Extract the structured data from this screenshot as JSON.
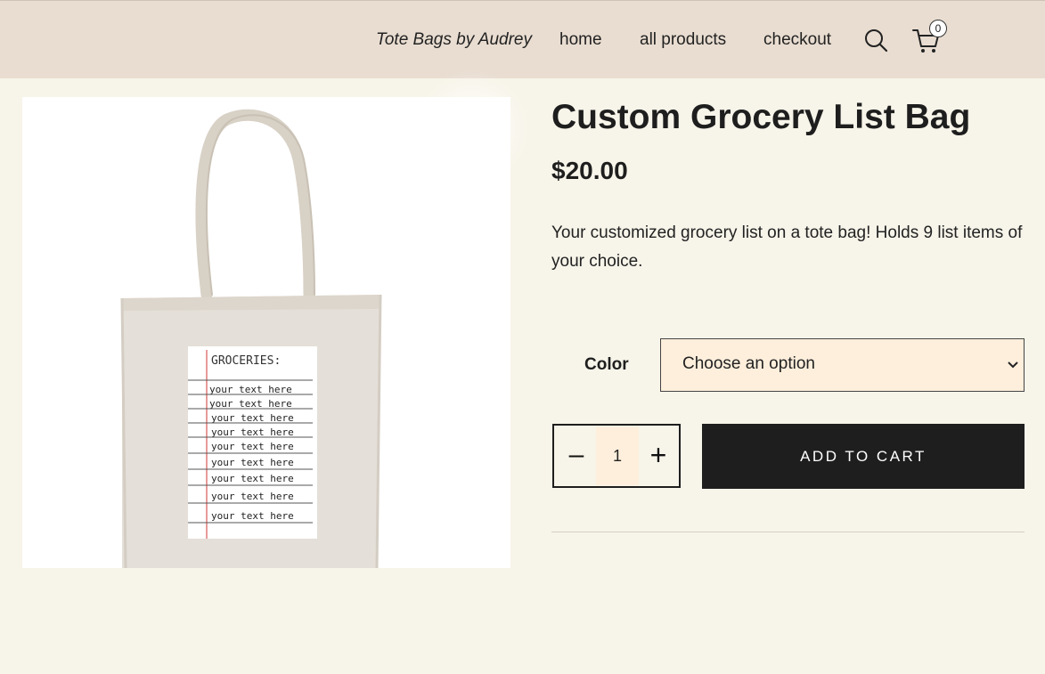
{
  "header": {
    "site_title": "Tote Bags by Audrey",
    "nav": {
      "home": "home",
      "all_products": "all products",
      "checkout": "checkout"
    },
    "cart_count": "0"
  },
  "product": {
    "title": "Custom Grocery List Bag",
    "price": "$20.00",
    "description": "Your customized grocery list on a tote bag!  Holds 9 list items of your choice.",
    "image": {
      "heading": "GROCERIES:",
      "lines": [
        "your text here",
        "your text here",
        "your text here",
        "your text here",
        "your text here",
        "your text here",
        "your text here",
        "your text here",
        "your text here"
      ]
    }
  },
  "options": {
    "color_label": "Color",
    "color_select_value": "Choose an option"
  },
  "cart_form": {
    "minus_label": "–",
    "quantity": "1",
    "plus_label": "+",
    "add_to_cart_label": "ADD TO CART"
  },
  "colors": {
    "header_bg": "#e9ddd1",
    "page_bg": "#f7f4e9",
    "button_bg": "#1e1e1e",
    "input_bg": "#fdefdc"
  }
}
